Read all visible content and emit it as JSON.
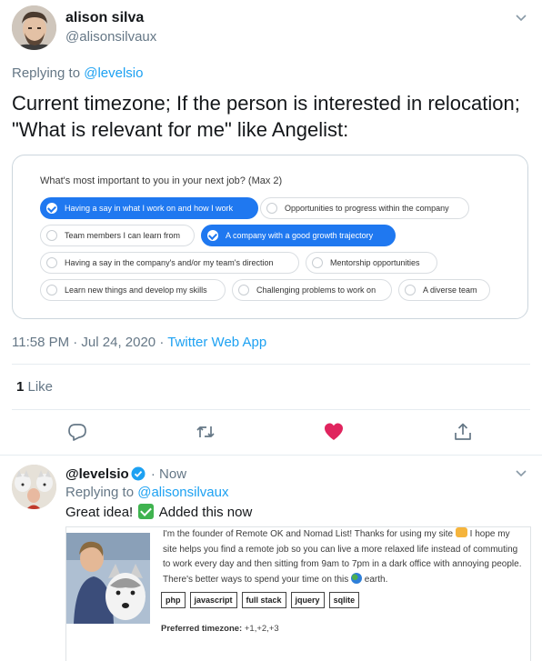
{
  "main_tweet": {
    "author_name": "alison silva",
    "author_handle": "@alisonsilvaux",
    "replying_prefix": "Replying to ",
    "replying_to": "@levelsio",
    "text": "Current timezone; If the person is interested in relocation; \"What is relevant for me\" like Angelist:",
    "timestamp": "11:58 PM · Jul 24, 2020 · ",
    "source_app": "Twitter Web App",
    "like_count": "1",
    "like_label": " Like"
  },
  "embedded_card": {
    "question": "What's most important to you in your next job? (Max 2)",
    "options": [
      {
        "label": "Having a say in what I work on and how I work",
        "selected": true
      },
      {
        "label": "Opportunities to progress within the company",
        "selected": false
      },
      {
        "label": "Team members I can learn from",
        "selected": false
      },
      {
        "label": "A company with a good growth trajectory",
        "selected": true
      },
      {
        "label": "Having a say in the company's and/or my team's direction",
        "selected": false
      },
      {
        "label": "Mentorship opportunities",
        "selected": false
      },
      {
        "label": "Learn new things and develop my skills",
        "selected": false
      },
      {
        "label": "Challenging problems to work on",
        "selected": false
      },
      {
        "label": "A diverse team",
        "selected": false
      }
    ]
  },
  "actions": {
    "icons": [
      "reply-icon",
      "retweet-icon",
      "like-icon-filled",
      "share-icon"
    ],
    "like_color": "#e0245e"
  },
  "reply_tweet": {
    "author_name": "@levelsio",
    "separator": " · ",
    "time": "Now",
    "replying_prefix": "Replying to ",
    "replying_to": "@alisonsilvaux",
    "text_before": "Great idea! ",
    "text_after": " Added this now"
  },
  "profile_card": {
    "bio_1": "I'm the founder of Remote OK and Nomad List! Thanks for using my site ",
    "bio_2": " I hope my site helps you find a remote job so you can live a more relaxed life instead of commuting to work every day and then sitting from 9am to 7pm in a dark office with annoying people. There's better ways to spend your time on this ",
    "bio_3": " earth.",
    "tags": [
      "php",
      "javascript",
      "full stack",
      "jquery",
      "sqlite"
    ],
    "timezone_label": "Preferred timezone:",
    "timezone_value": " +1,+2,+3"
  },
  "colors": {
    "accent": "#1da1f2",
    "selected_pill": "#1f78f0",
    "muted": "#657786",
    "check_green": "#3fb34f"
  }
}
